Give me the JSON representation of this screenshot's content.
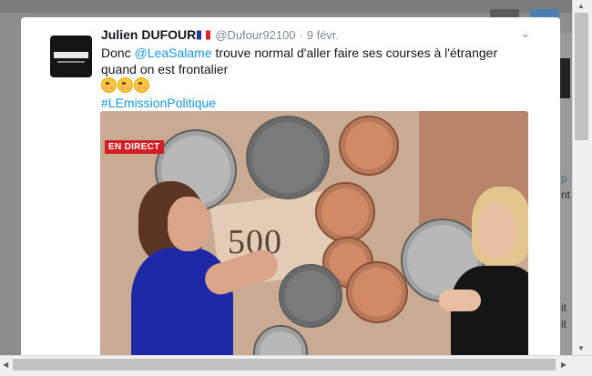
{
  "tweet": {
    "author_name": "Julien DUFOUR",
    "handle": "@Dufour92100",
    "separator": "·",
    "date": "9 févr.",
    "text_before": "Donc ",
    "mention": "@LeaSalame",
    "text_after": " trouve normal d'aller faire ses courses à l'étranger quand on est frontalier",
    "hashtag": "#LEmissionPolitique",
    "emoji_count": 3,
    "icons": {
      "flag": "france-flag-icon",
      "caret": "chevron-down-icon",
      "emoji": "flushed-face-emoji-icon"
    }
  },
  "media": {
    "live_badge": "EN DIRECT",
    "bill_number": "500"
  },
  "background_peek": {
    "lines": [
      "p.",
      "nt",
      "it",
      "it"
    ]
  },
  "colors": {
    "link": "#1b95e0",
    "live_badge": "#d21f25",
    "backdrop": "#8d8d8d"
  }
}
